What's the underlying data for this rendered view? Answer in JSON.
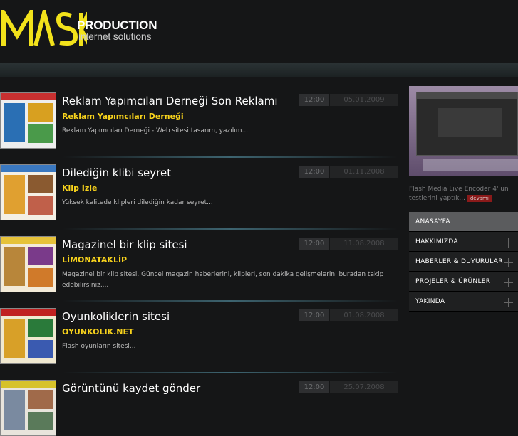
{
  "brand": {
    "logo_text": "MASK",
    "production": "PRODUCTION",
    "tagline": "internet solutions",
    "accent_color": "#f2e21b"
  },
  "items": [
    {
      "title": "Reklam Yapımcıları Derneği Son Reklamı",
      "subtitle": "Reklam Yapımcıları Derneği",
      "desc": "Reklam Yapımcıları Derneği - Web sitesi tasarım, yazılım...",
      "time": "12:00",
      "date": "05.01.2009"
    },
    {
      "title": "Dilediğin klibi seyret",
      "subtitle": "Klip İzle",
      "desc": "Yüksek kalitede klipleri dilediğin kadar seyret...",
      "time": "12:00",
      "date": "01.11.2008"
    },
    {
      "title": "Magazinel bir klip sitesi",
      "subtitle": "LİMONATAKLİP",
      "desc": "Magazinel bir klip sitesi. Güncel magazin haberlerini, klipleri, son dakika gelişmelerini buradan takip edebilirsiniz....",
      "time": "12:00",
      "date": "11.08.2008"
    },
    {
      "title": "Oyunkoliklerin sitesi",
      "subtitle": "OYUNKOLIK.NET",
      "desc": "Flash oyunların sitesi...",
      "time": "12:00",
      "date": "01.08.2008"
    },
    {
      "title": "Görüntünü kaydet gönder",
      "subtitle": "",
      "desc": "",
      "time": "12:00",
      "date": "25.07.2008"
    }
  ],
  "sidebar": {
    "promo_text": "Flash Media Live Encoder 4' ün testlerini yaptık...",
    "more_label": "devamı",
    "menu": [
      {
        "label": "ANASAYFA",
        "active": true
      },
      {
        "label": "HAKKIMIZDA",
        "active": false
      },
      {
        "label": "HABERLER & DUYURULAR",
        "active": false
      },
      {
        "label": "PROJELER & ÜRÜNLER",
        "active": false
      },
      {
        "label": "YAKINDA",
        "active": false
      }
    ]
  }
}
